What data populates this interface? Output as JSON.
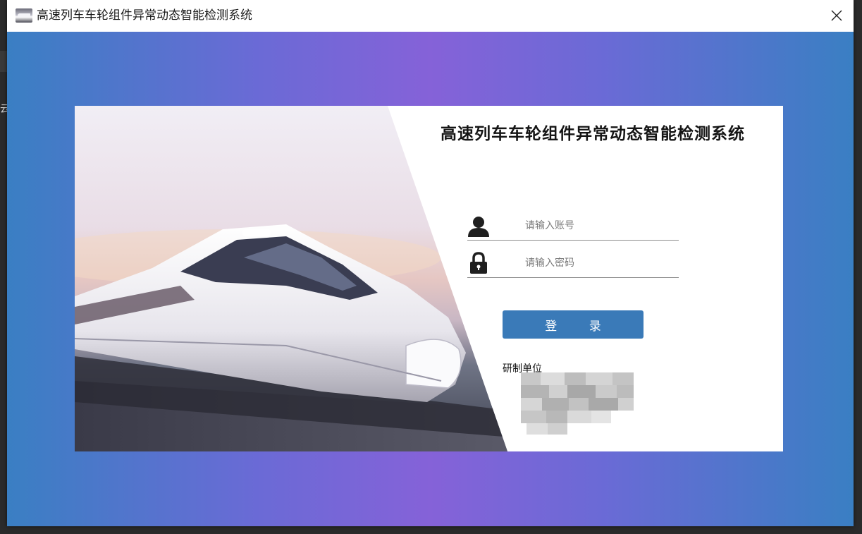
{
  "window": {
    "title": "高速列车车轮组件异常动态智能检测系统",
    "desktop_glyph": "云"
  },
  "login": {
    "system_title": "高速列车车轮组件异常动态智能检测系统",
    "username_placeholder": "请输入账号",
    "password_placeholder": "请输入密码",
    "login_button": "登 录",
    "org_label": "研制单位"
  },
  "icons": {
    "app": "train-icon",
    "close": "close-icon",
    "user": "user-icon",
    "lock": "lock-icon"
  },
  "colors": {
    "gradient_edge": "#3a7fc3",
    "gradient_center": "#8562d8",
    "login_button": "#3a7ab8",
    "card": "#ffffff"
  }
}
